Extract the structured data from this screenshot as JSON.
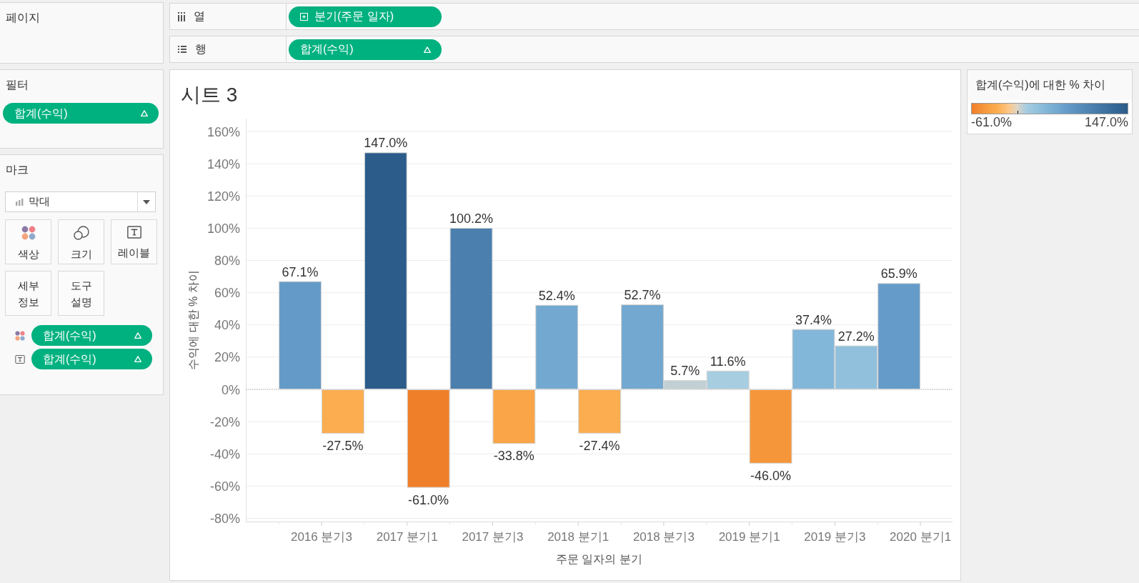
{
  "pages_card": {
    "title": "페이지"
  },
  "filters_card": {
    "title": "필터",
    "pills": [
      {
        "label": "합계(수익)",
        "table_calc": true
      }
    ]
  },
  "marks_card": {
    "title": "마크",
    "mark_type": "막대",
    "buttons": [
      {
        "kind": "color",
        "label": "색상"
      },
      {
        "kind": "size",
        "label": "크기"
      },
      {
        "kind": "label",
        "label": "레이블"
      },
      {
        "kind": "detail",
        "label": "세부 정보"
      },
      {
        "kind": "tooltip",
        "label": "도구 설명"
      }
    ],
    "fields": [
      {
        "kind": "color",
        "label": "합계(수익)",
        "table_calc": true
      },
      {
        "kind": "label",
        "label": "합계(수익)",
        "table_calc": true
      }
    ]
  },
  "shelves": [
    {
      "kind": "columns",
      "title": "열",
      "pills": [
        {
          "kind": "dimension",
          "label": "분기(주문 일자)",
          "table_calc": false
        }
      ]
    },
    {
      "kind": "rows",
      "title": "행",
      "pills": [
        {
          "kind": "measure",
          "label": "합계(수익)",
          "table_calc": true
        }
      ]
    }
  ],
  "sheet": {
    "chart_data": {
      "type": "bar",
      "title": "시트 3",
      "xlabel": "주문 일자의 분기",
      "ylabel": "수익에 대한 % 차이",
      "categories": [
        "2016 분기3",
        null,
        "2017 분기1",
        null,
        "2017 분기3",
        null,
        "2018 분기1",
        null,
        "2018 분기3",
        null,
        "2019 분기1",
        null,
        "2019 분기3",
        null,
        "2020 분기1"
      ],
      "values": [
        67.1,
        -27.5,
        147.0,
        -61.0,
        100.2,
        -33.8,
        52.4,
        -27.4,
        52.7,
        5.7,
        11.6,
        -46.0,
        37.4,
        27.2,
        65.9
      ],
      "ylim": [
        -82,
        168
      ],
      "yticks": [
        {
          "value": -80,
          "label": "-80%"
        },
        {
          "value": -60,
          "label": "-60%"
        },
        {
          "value": -40,
          "label": "-40%"
        },
        {
          "value": -20,
          "label": "-20%"
        },
        {
          "value": 0,
          "label": "0%"
        },
        {
          "value": 20,
          "label": "20%"
        },
        {
          "value": 40,
          "label": "40%"
        },
        {
          "value": 60,
          "label": "60%"
        },
        {
          "value": 80,
          "label": "80%"
        },
        {
          "value": 100,
          "label": "100%"
        },
        {
          "value": 120,
          "label": "120%"
        },
        {
          "value": 140,
          "label": "140%"
        },
        {
          "value": 160,
          "label": "160%"
        }
      ],
      "grid": true,
      "ref_lines": [
        {
          "axis": "y",
          "value": 0
        }
      ],
      "value_labels": [
        "67.1%",
        "-27.5%",
        "147.0%",
        "-61.0%",
        "100.2%",
        "-33.8%",
        "52.4%",
        "-27.4%",
        "52.7%",
        "5.7%",
        "11.6%",
        "-46.0%",
        "37.4%",
        "27.2%",
        "65.9%"
      ]
    }
  },
  "legend": {
    "title": "합계(수익)에 대한 % 차이",
    "min_label": "-61.0%",
    "max_label": "147.0%"
  }
}
